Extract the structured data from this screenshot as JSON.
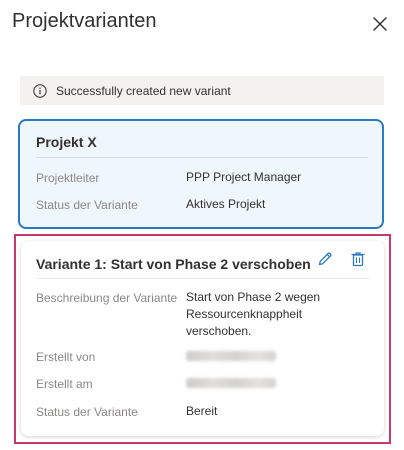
{
  "header": {
    "title": "Projektvarianten"
  },
  "icons": {
    "close": "close-icon",
    "info": "info-icon",
    "edit": "edit-pencil-icon",
    "delete": "trash-icon"
  },
  "notification": {
    "text": "Successfully created new variant"
  },
  "project_card": {
    "title": "Projekt X",
    "rows": [
      {
        "label": "Projektleiter",
        "value": "PPP Project Manager"
      },
      {
        "label": "Status der Variante",
        "value": "Aktives Projekt"
      }
    ]
  },
  "variant_card": {
    "title": "Variante 1: Start von Phase 2 verschoben",
    "rows": [
      {
        "label": "Beschreibung der Variante",
        "value_lines": [
          "Start von Phase 2 wegen",
          "Ressourcenknappheit",
          "verschoben."
        ]
      },
      {
        "label": "Erstellt von",
        "value": ""
      },
      {
        "label": "Erstellt am",
        "value": ""
      },
      {
        "label": "Status der Variante",
        "value": "Bereit"
      }
    ]
  },
  "colors": {
    "accent_blue": "#2b79c2",
    "highlight_border": "#c8376e",
    "project_card_bg": "#eff6fc",
    "notification_bg": "#f3f2f1"
  }
}
